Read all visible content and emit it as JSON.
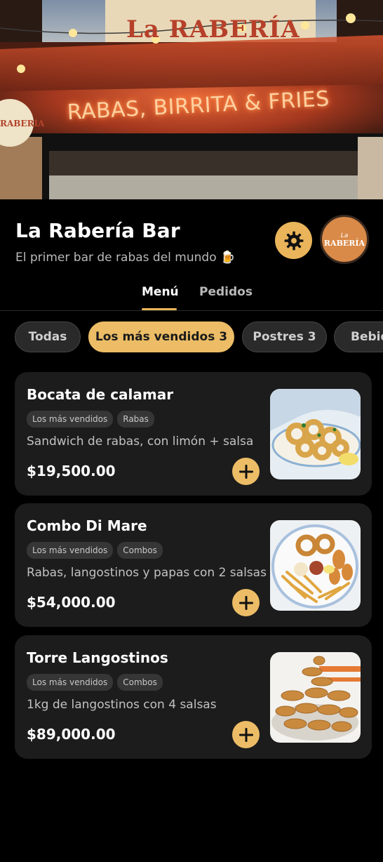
{
  "hero": {
    "sign_text": "RABAS, BIRRITA & FRIES",
    "sign_logo": "La RABERÍA"
  },
  "header": {
    "title": "La Rabería Bar",
    "subtitle": "El primer bar de rabas del mundo",
    "subtitle_emoji": "🍺",
    "settings_icon": "gear-icon",
    "logo_top": "La",
    "logo_main": "RABERÍA"
  },
  "tabs": [
    {
      "label": "Menú",
      "active": true
    },
    {
      "label": "Pedidos",
      "active": false
    }
  ],
  "chips": [
    {
      "label": "Todas",
      "active": false
    },
    {
      "label": "Los más vendidos 3",
      "active": true
    },
    {
      "label": "Postres 3",
      "active": false
    },
    {
      "label": "Bebid",
      "active": false
    }
  ],
  "items": [
    {
      "name": "Bocata de calamar",
      "tags": [
        "Los más vendidos",
        "Rabas"
      ],
      "description": "Sandwich de rabas, con limón + salsa",
      "price": "$19,500.00"
    },
    {
      "name": "Combo Di Mare",
      "tags": [
        "Los más vendidos",
        "Combos"
      ],
      "description": "Rabas, langostinos y papas con 2 salsas",
      "price": "$54,000.00"
    },
    {
      "name": "Torre Langostinos",
      "tags": [
        "Los más vendidos",
        "Combos"
      ],
      "description": "1kg de langostinos con 4 salsas",
      "price": "$89,000.00"
    }
  ],
  "colors": {
    "accent": "#ecbd66",
    "background": "#000000",
    "card": "#1c1c1c"
  }
}
